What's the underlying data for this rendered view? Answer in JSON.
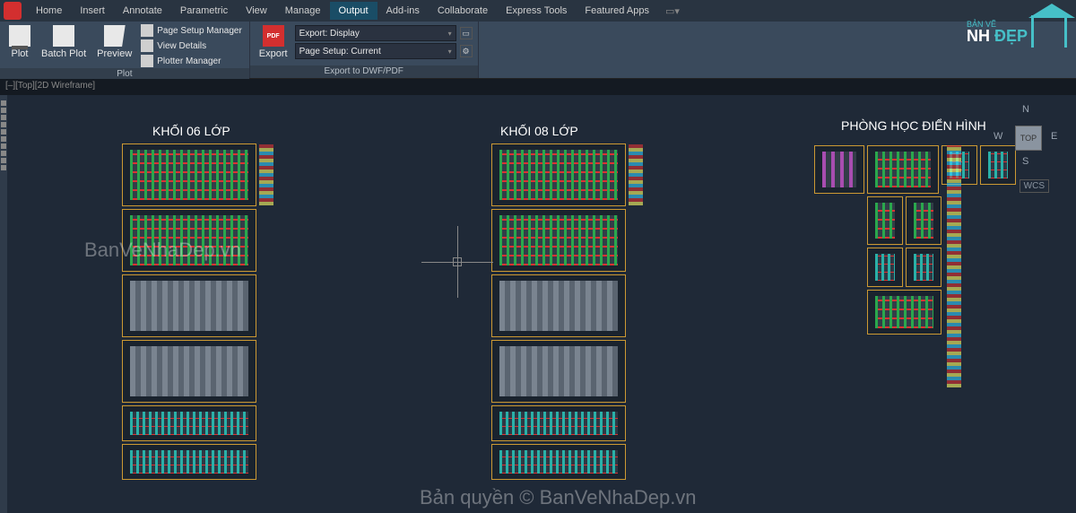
{
  "menu": {
    "items": [
      "Home",
      "Insert",
      "Annotate",
      "Parametric",
      "View",
      "Manage",
      "Output",
      "Add-ins",
      "Collaborate",
      "Express Tools",
      "Featured Apps"
    ],
    "active_index": 6,
    "search_glyph": "▭▾"
  },
  "ribbon": {
    "plot_panel": {
      "title": "Plot",
      "plot": "Plot",
      "batch": "Batch Plot",
      "preview": "Preview",
      "page_setup": "Page Setup Manager",
      "view_details": "View Details",
      "plotter_mgr": "Plotter Manager"
    },
    "export_panel": {
      "title": "Export to DWF/PDF",
      "export": "Export",
      "export_icon_text": "PDF",
      "dropdown_export_label": "Export:",
      "dropdown_export_value": "Display",
      "dropdown_pagesetup_label": "Page Setup:",
      "dropdown_pagesetup_value": "Current"
    }
  },
  "breadcrumb": "[–][Top][2D Wireframe]",
  "sections": {
    "col1_title": "KHỐI 06 LỚP",
    "col2_title": "KHỐI 08 LỚP",
    "col3_title": "PHÒNG HỌC ĐIỂN HÌNH"
  },
  "viewcube": {
    "n": "N",
    "e": "E",
    "s": "S",
    "w": "W",
    "top": "TOP",
    "wcs": "WCS"
  },
  "minmax": "– □ ×",
  "watermarks": {
    "left": "BanVeNhaDep.vn",
    "bottom": "Bản quyền © BanVeNhaDep.vn"
  },
  "brand": {
    "small": "BẢN VẼ",
    "nh": "NH",
    "dep": "ĐẸP"
  }
}
